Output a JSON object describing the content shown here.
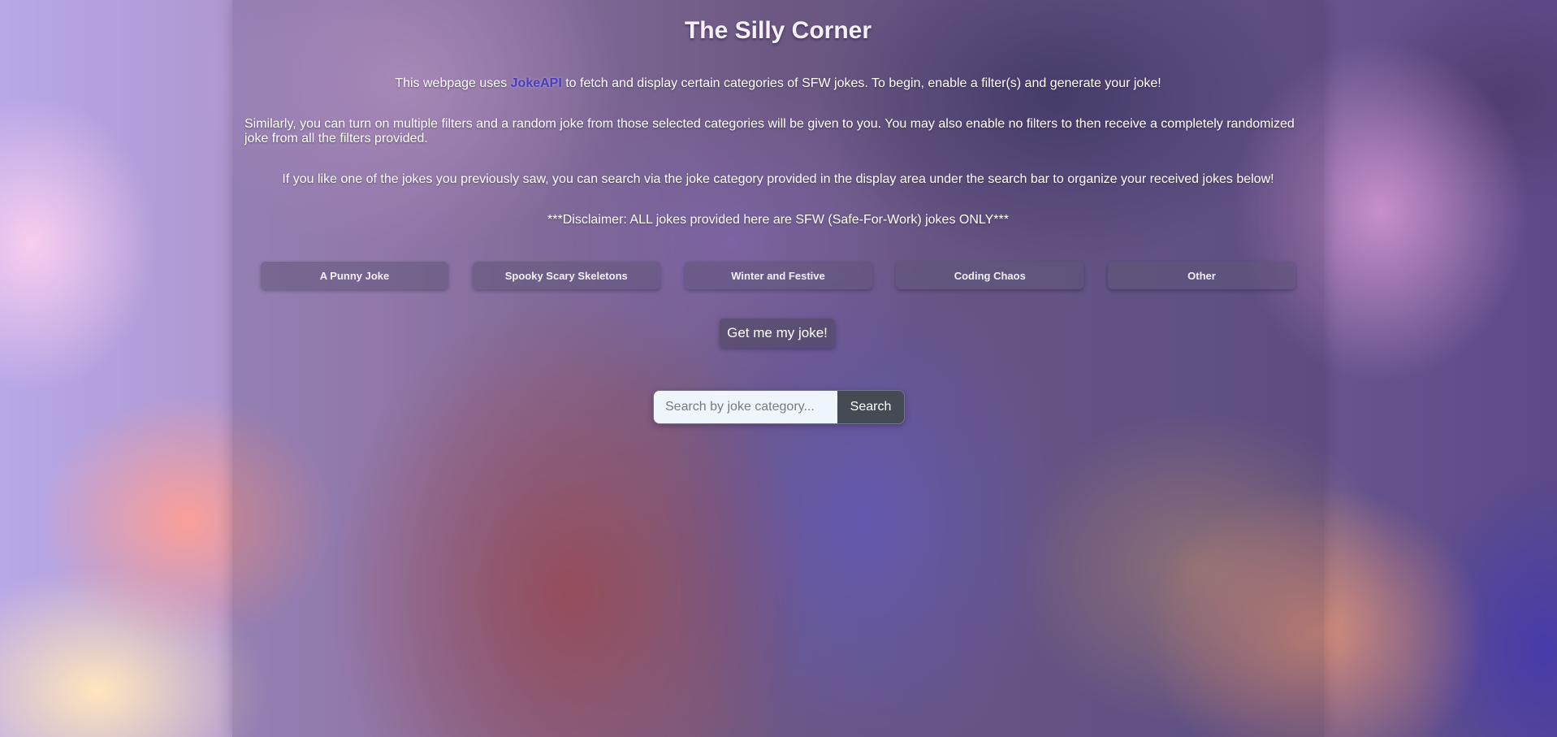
{
  "header": {
    "title": "The Silly Corner"
  },
  "intro": {
    "p1_before": "This webpage uses ",
    "p1_link": "JokeAPI",
    "p1_after": " to fetch and display certain categories of SFW jokes. To begin, enable a filter(s) and generate your joke!",
    "p2": "Similarly, you can turn on multiple filters and a random joke from those selected categories will be given to you. You may also enable no filters to then receive a completely randomized joke from all the filters provided.",
    "p3": "If you like one of the jokes you previously saw, you can search via the joke category provided in the display area under the search bar to organize your received jokes below!",
    "p4": "***Disclaimer: ALL jokes provided here are SFW (Safe-For-Work) jokes ONLY***"
  },
  "filters": [
    {
      "label": "A Punny Joke"
    },
    {
      "label": "Spooky Scary Skeletons"
    },
    {
      "label": "Winter and Festive"
    },
    {
      "label": "Coding Chaos"
    },
    {
      "label": "Other"
    }
  ],
  "actions": {
    "get_joke_label": "Get me my joke!"
  },
  "search": {
    "placeholder": "Search by joke category...",
    "value": "",
    "button_label": "Search"
  },
  "colors": {
    "link": "#4a3fb8",
    "search_button_bg": "#454b55",
    "search_input_bg": "#eef6fb"
  }
}
